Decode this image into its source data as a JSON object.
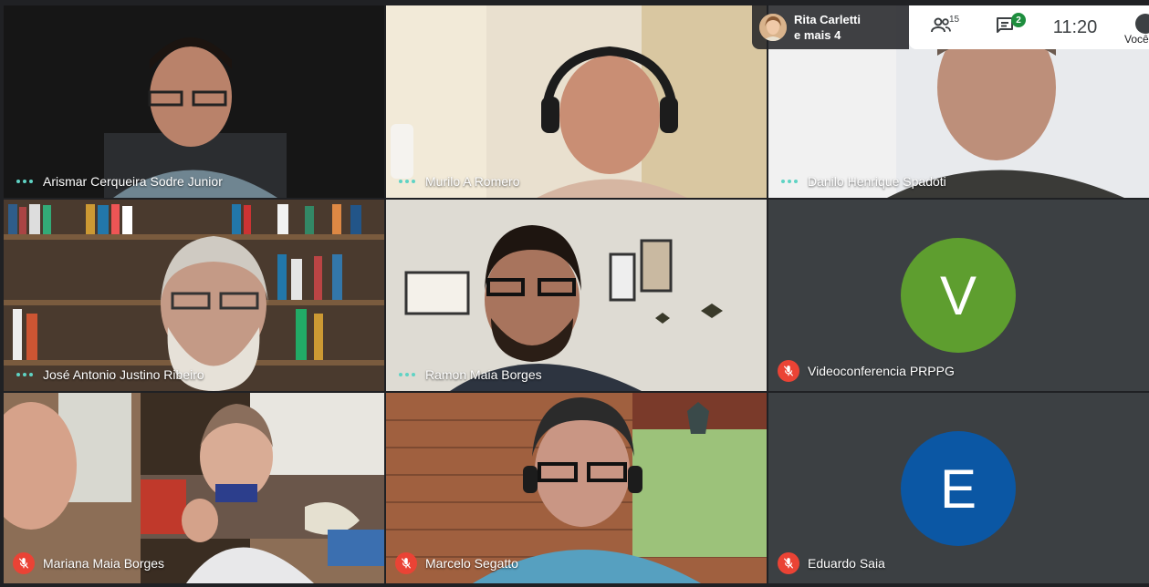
{
  "presenter": {
    "name": "Rita Carletti",
    "others": "e mais 4"
  },
  "toolbar": {
    "participants_count": "15",
    "chat_count": "2",
    "time": "11:20",
    "you_label": "Você"
  },
  "participants": [
    {
      "name": "Arismar Cerqueira Sodre Junior",
      "status": "speaking"
    },
    {
      "name": "Murilo A Romero",
      "status": "speaking"
    },
    {
      "name": "Danilo Henrique Spadoti",
      "status": "speaking"
    },
    {
      "name": "José Antonio Justino Ribeiro",
      "status": "speaking"
    },
    {
      "name": "Ramon Maia Borges",
      "status": "speaking"
    },
    {
      "name": "Videoconferencia PRPPG",
      "status": "muted",
      "initial": "V",
      "color": "#5e9e2f"
    },
    {
      "name": "Mariana Maia Borges",
      "status": "muted"
    },
    {
      "name": "Marcelo Segatto",
      "status": "muted"
    },
    {
      "name": "Eduardo Saia",
      "status": "muted",
      "initial": "E",
      "color": "#0b57a4"
    }
  ],
  "colors": {
    "speaking_indicator": "#5fd3c4",
    "mute_badge": "#ea4335",
    "tile_bg": "#202124"
  }
}
